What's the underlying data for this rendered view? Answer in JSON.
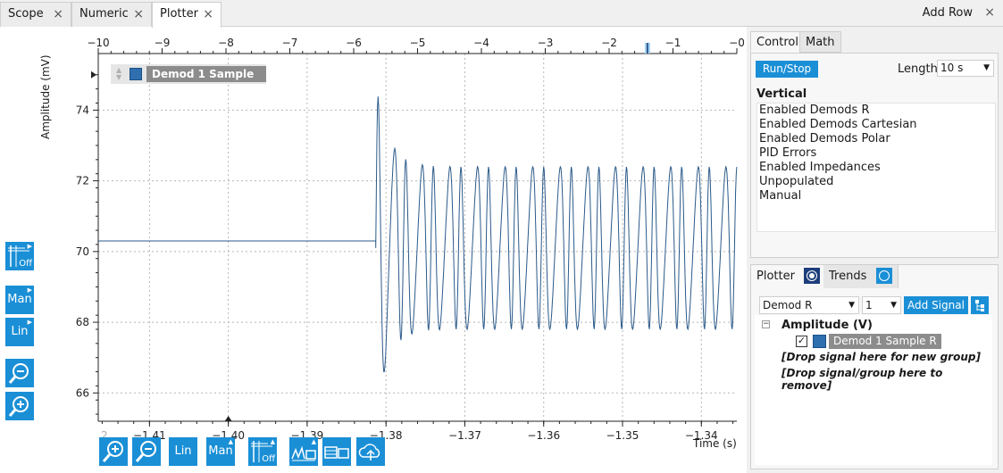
{
  "tabs": [
    {
      "label": "Scope",
      "close": "×"
    },
    {
      "label": "Numeric",
      "close": "×"
    },
    {
      "label": "Plotter",
      "close": "×",
      "active": true
    }
  ],
  "add_row": {
    "label": "Add Row",
    "close": "×"
  },
  "plot": {
    "y_axis_label": "Amplitude (mV)",
    "x_axis_label": "Time (s)",
    "top_ticks": [
      "−10",
      "−9",
      "−8",
      "−7",
      "−6",
      "−5",
      "−4",
      "−3",
      "−2",
      "−1",
      "−0"
    ],
    "bottom_ticks": [
      "−1.41",
      "−1.40",
      "−1.39",
      "−1.38",
      "−1.37",
      "−1.36",
      "−1.35",
      "−1.34"
    ],
    "bottom_edge_tick": "2",
    "y_ticks": [
      "74",
      "72",
      "70",
      "68",
      "66"
    ],
    "legend_label": "Demod 1 Sample R",
    "trace_color": "#2a5a8a"
  },
  "chart_data": {
    "type": "line",
    "title": "",
    "xlabel": "Time (s)",
    "ylabel": "Amplitude (mV)",
    "xlim": [
      -1.4165,
      -1.3355
    ],
    "ylim": [
      65.2,
      75.6
    ],
    "top_xlim": [
      -10,
      0
    ],
    "series": [
      {
        "name": "Demod 1 Sample R",
        "x_start": -1.4165,
        "flat_value": 70.3,
        "step_time": -1.3813,
        "peak_value": 75.0,
        "osc_center": 70.1,
        "osc_min": 68.0,
        "osc_max": 72.6,
        "osc_period_s": 0.00175
      }
    ]
  },
  "left_tools": [
    {
      "icon": "grid-off-icon",
      "label": "Off"
    },
    {
      "icon": "y-range-mode-icon",
      "label": "Man"
    },
    {
      "icon": "y-scale-icon",
      "label": "Lin"
    },
    {
      "icon": "zoom-out-icon",
      "label": ""
    },
    {
      "icon": "zoom-in-icon",
      "label": ""
    }
  ],
  "bottom_tools": [
    {
      "icon": "zoom-in-icon",
      "label": ""
    },
    {
      "icon": "zoom-out-icon",
      "label": ""
    },
    {
      "icon": "x-scale-icon",
      "label": "Lin"
    },
    {
      "icon": "x-range-mode-icon",
      "label": "Man"
    },
    {
      "icon": "grid-off-icon",
      "label": "Off"
    },
    {
      "icon": "cursor-folder-icon",
      "label": ""
    },
    {
      "icon": "table-folder-icon",
      "label": ""
    },
    {
      "icon": "cloud-upload-icon",
      "label": ""
    }
  ],
  "control_panel": {
    "tabs": [
      "Control",
      "Math"
    ],
    "run_stop": "Run/Stop",
    "length_label": "Length",
    "length_value": "10 s",
    "vertical_title": "Vertical",
    "vertical_items": [
      "Enabled Demods R",
      "Enabled Demods Cartesian",
      "Enabled Demods Polar",
      "PID Errors",
      "Enabled Impedances",
      "Unpopulated",
      "Manual"
    ]
  },
  "plotter_panel": {
    "tabs": [
      "Plotter",
      "Trends"
    ],
    "signal_select": "Demod R",
    "channel_select": "1",
    "add_signal": "Add Signal",
    "group_name": "Amplitude (V)",
    "expander": "−",
    "checkbox": "✓",
    "signal_name": "Demod 1 Sample R",
    "drop_new_group": "[Drop signal here for new group]",
    "drop_remove": "[Drop signal/group here to remove]"
  }
}
